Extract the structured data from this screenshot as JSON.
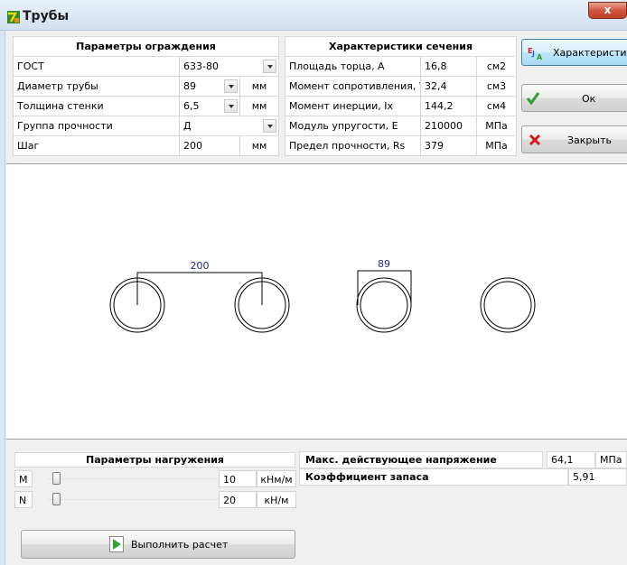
{
  "window": {
    "title": "Трубы",
    "close_glyph": "x"
  },
  "barrier": {
    "header": "Параметры ограждения",
    "rows": [
      {
        "label": "ГОСТ",
        "value": "633-80",
        "unit": ""
      },
      {
        "label": "Диаметр трубы",
        "value": "89",
        "unit": "мм"
      },
      {
        "label": "Толщина стенки",
        "value": "6,5",
        "unit": "мм"
      },
      {
        "label": "Группа прочности",
        "value": "Д",
        "unit": ""
      },
      {
        "label": "Шаг",
        "value": "200",
        "unit": "мм"
      }
    ]
  },
  "section": {
    "header": "Характеристики  сечения",
    "rows": [
      {
        "label": "Площадь торца, А",
        "value": "16,8",
        "unit": "см2"
      },
      {
        "label": "Момент сопротивления, Wx",
        "value": "32,4",
        "unit": "см3"
      },
      {
        "label": "Момент инерции, Ix",
        "value": "144,2",
        "unit": "см4"
      },
      {
        "label": "Модуль упругости, Е",
        "value": "210000",
        "unit": "МПа"
      },
      {
        "label": "Предел прочности, Rs",
        "value": "379",
        "unit": "МПа"
      }
    ]
  },
  "buttons": {
    "characteristics": "Характеристики",
    "characteristics_icon": "E J A",
    "ok": "Ок",
    "close": "Закрыть",
    "run": "Выполнить расчет"
  },
  "drawing": {
    "step_label": "200",
    "diameter_label": "89",
    "line_color": "#000000",
    "label_color": "#1f2d8a"
  },
  "load": {
    "header": "Параметры нагружения",
    "rows": [
      {
        "label": "M",
        "value": "10",
        "unit": "кНм/м",
        "level": 0.05
      },
      {
        "label": "N",
        "value": "20",
        "unit": "кН/м",
        "level": 0.05
      }
    ]
  },
  "results": {
    "stress_label": "Макс. действующее напряжение",
    "stress_value": "64,1",
    "stress_unit": "МПа",
    "safety_label": "Коэффициент запаса",
    "safety_value": "5,91"
  },
  "colors": {
    "ok_check": "#2da02d",
    "close_x": "#d31b1b",
    "run_arrow": "#2ea42e"
  }
}
